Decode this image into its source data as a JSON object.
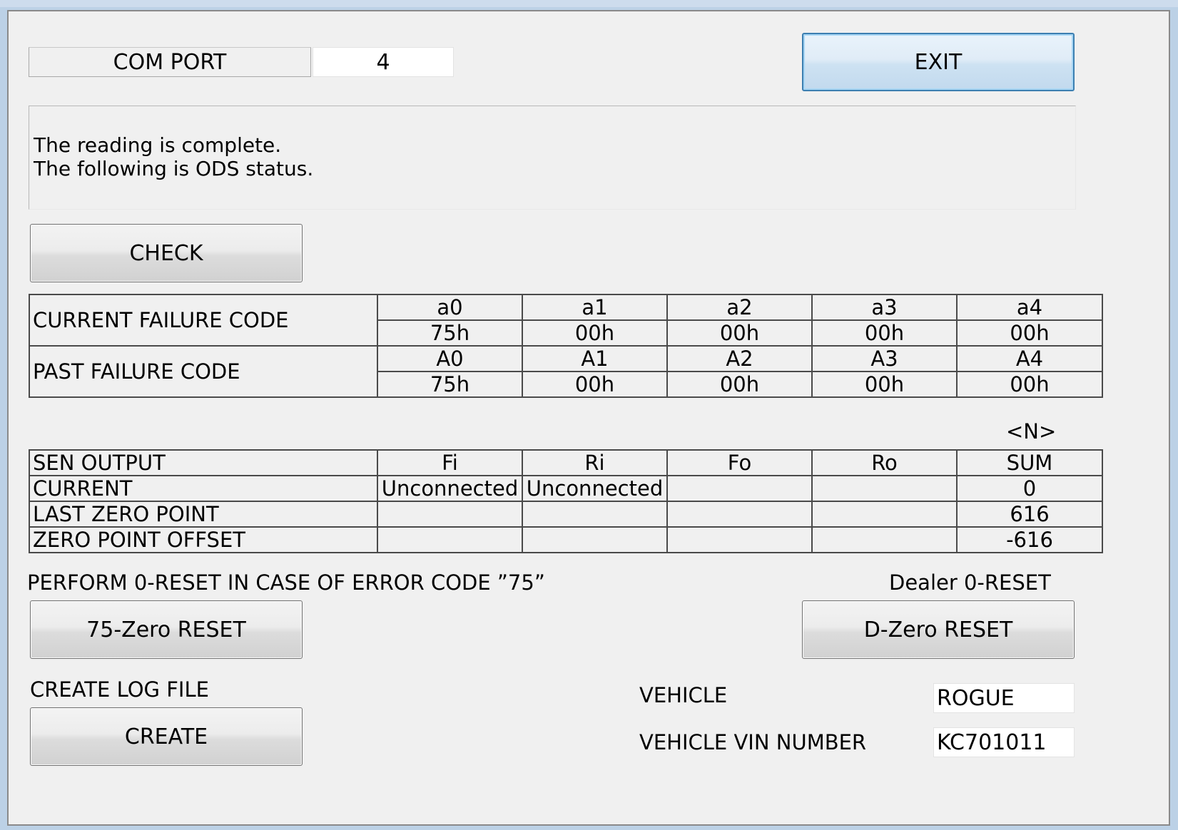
{
  "com_port": {
    "label": "COM PORT",
    "value": "4"
  },
  "buttons": {
    "exit": "EXIT",
    "check": "CHECK",
    "zero75": "75-Zero RESET",
    "dzero": "D-Zero RESET",
    "create": "CREATE"
  },
  "message": {
    "line1": "The reading is complete.",
    "line2": "The following is ODS status."
  },
  "failure_table": {
    "current_label": "CURRENT FAILURE CODE",
    "past_label": "PAST FAILURE CODE",
    "current_headers": [
      "a0",
      "a1",
      "a2",
      "a3",
      "a4"
    ],
    "current_values": [
      "75h",
      "00h",
      "00h",
      "00h",
      "00h"
    ],
    "past_headers": [
      "A0",
      "A1",
      "A2",
      "A3",
      "A4"
    ],
    "past_values": [
      "75h",
      "00h",
      "00h",
      "00h",
      "00h"
    ]
  },
  "unit_label": "<N>",
  "sensor_table": {
    "header": [
      "SEN OUTPUT",
      "Fi",
      "Ri",
      "Fo",
      "Ro",
      "SUM"
    ],
    "rows": [
      [
        "CURRENT",
        "Unconnected",
        "Unconnected",
        "",
        "",
        "0"
      ],
      [
        "LAST ZERO POINT",
        "",
        "",
        "",
        "",
        "616"
      ],
      [
        "ZERO POINT OFFSET",
        "",
        "",
        "",
        "",
        "-616"
      ]
    ]
  },
  "reset_note": "PERFORM 0-RESET IN CASE OF ERROR CODE ”75”",
  "dealer_label": "Dealer 0-RESET",
  "log_label": "CREATE LOG FILE",
  "vehicle": {
    "label": "VEHICLE",
    "value": "ROGUE"
  },
  "vin": {
    "label": "VEHICLE VIN NUMBER",
    "value": "KC701011"
  }
}
